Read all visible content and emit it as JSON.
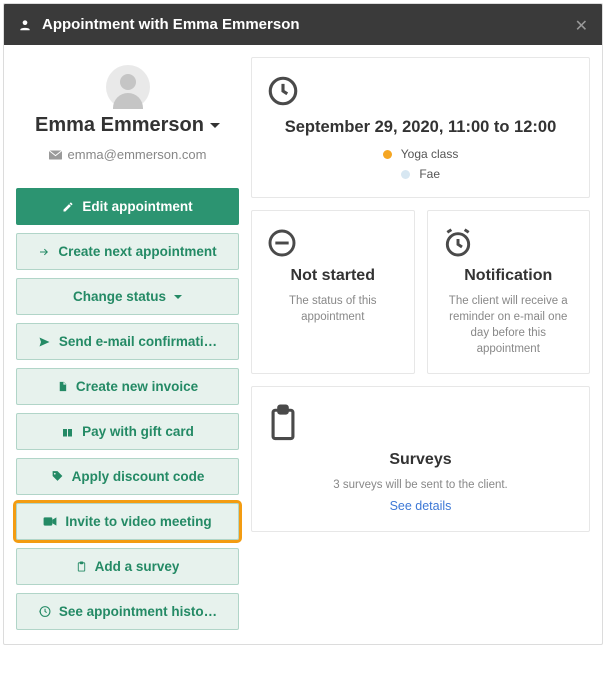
{
  "header": {
    "title": "Appointment with Emma Emmerson"
  },
  "client": {
    "name": "Emma Emmerson",
    "email": "emma@emmerson.com"
  },
  "actions": {
    "edit": "Edit appointment",
    "create_next": "Create next appointment",
    "change_status": "Change status",
    "send_email": "Send e-mail confirmati…",
    "create_invoice": "Create new invoice",
    "pay_giftcard": "Pay with gift card",
    "discount": "Apply discount code",
    "video": "Invite to video meeting",
    "add_survey": "Add a survey",
    "history": "See appointment histo…"
  },
  "datetime": {
    "label": "September 29, 2020, 11:00 to 12:00",
    "class_name": "Yoga class",
    "class_color": "#f5a623",
    "staff_name": "Fae",
    "staff_color": "#d7e7f2"
  },
  "status": {
    "title": "Not started",
    "desc": "The status of this appointment"
  },
  "notification": {
    "title": "Notification",
    "desc": "The client will receive a reminder on e-mail one day before this appointment"
  },
  "surveys": {
    "title": "Surveys",
    "desc": "3 surveys will be sent to the client.",
    "link": "See details"
  }
}
